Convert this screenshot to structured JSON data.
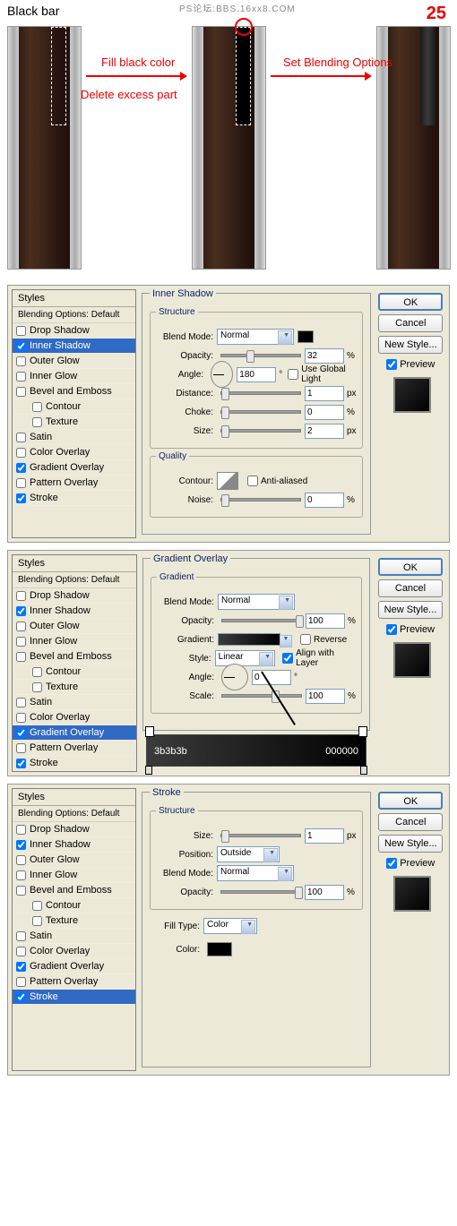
{
  "top": {
    "watermark": "PS论坛:BBS.16xx8.COM",
    "step": "25",
    "title": "Black bar",
    "inst1": "Fill black color",
    "inst2": "Delete excess part",
    "inst3": "Set Blending Options"
  },
  "styles_hdr": "Styles",
  "styles_sub": "Blending Options: Default",
  "style_items": {
    "drop_shadow": "Drop Shadow",
    "inner_shadow": "Inner Shadow",
    "outer_glow": "Outer Glow",
    "inner_glow": "Inner Glow",
    "bevel": "Bevel and Emboss",
    "contour": "Contour",
    "texture": "Texture",
    "satin": "Satin",
    "color_overlay": "Color Overlay",
    "gradient_overlay": "Gradient Overlay",
    "pattern_overlay": "Pattern Overlay",
    "stroke": "Stroke"
  },
  "btns": {
    "ok": "OK",
    "cancel": "Cancel",
    "new_style": "New Style...",
    "preview": "Preview"
  },
  "d1": {
    "title": "Inner Shadow",
    "structure": "Structure",
    "quality": "Quality",
    "blend_mode_lbl": "Blend Mode:",
    "blend_mode_val": "Normal",
    "opacity_lbl": "Opacity:",
    "opacity_val": "32",
    "angle_lbl": "Angle:",
    "angle_val": "180",
    "use_global": "Use Global Light",
    "distance_lbl": "Distance:",
    "distance_val": "1",
    "choke_lbl": "Choke:",
    "choke_val": "0",
    "size_lbl": "Size:",
    "size_val": "2",
    "contour_lbl": "Contour:",
    "antialiased": "Anti-aliased",
    "noise_lbl": "Noise:",
    "noise_val": "0",
    "pct": "%",
    "deg": "°",
    "px": "px"
  },
  "d2": {
    "title": "Gradient Overlay",
    "gradient": "Gradient",
    "blend_mode_lbl": "Blend Mode:",
    "blend_mode_val": "Normal",
    "opacity_lbl": "Opacity:",
    "opacity_val": "100",
    "gradient_lbl": "Gradient:",
    "reverse": "Reverse",
    "style_lbl": "Style:",
    "style_val": "Linear",
    "align": "Align with Layer",
    "angle_lbl": "Angle:",
    "angle_val": "0",
    "scale_lbl": "Scale:",
    "scale_val": "100",
    "stop1": "3b3b3b",
    "stop2": "000000",
    "pct": "%",
    "deg": "°"
  },
  "d3": {
    "title": "Stroke",
    "structure": "Structure",
    "size_lbl": "Size:",
    "size_val": "1",
    "position_lbl": "Position:",
    "position_val": "Outside",
    "blend_mode_lbl": "Blend Mode:",
    "blend_mode_val": "Normal",
    "opacity_lbl": "Opacity:",
    "opacity_val": "100",
    "fill_type_lbl": "Fill Type:",
    "fill_type_val": "Color",
    "color_lbl": "Color:",
    "pct": "%",
    "px": "px"
  }
}
